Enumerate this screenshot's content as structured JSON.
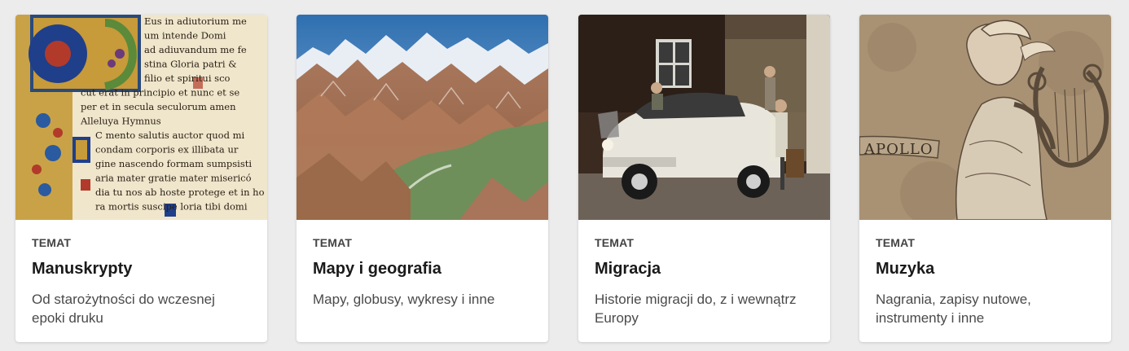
{
  "cards": [
    {
      "image": "illuminated-manuscript-image",
      "label": "TEMAT",
      "title": "Manuskrypty",
      "description": "Od starożytności do wczesnej epoki druku",
      "ms_lines": [
        "Eus in adiutorium me",
        "um intende  Domi",
        "ad adiuvandum me fe",
        "stina  Gloria patri &",
        "filio et spiritui sco",
        "cut erat in principio et nunc et se",
        "per et in secula seculorum amen",
        "Alleluya          Hymnus",
        "C mento salutis auctor quod mi",
        "condam corporis ex illibata ur",
        "gine nascendo formam sumpsisti",
        "aria mater gratie mater misericó",
        "dia tu nos ab hoste protege et in ho",
        "ra mortis suscipe  loria tibi domi"
      ]
    },
    {
      "image": "alpine-panorama-map-image",
      "label": "TEMAT",
      "title": "Mapy i geografia",
      "description": "Mapy, globusy, wykresy i inne"
    },
    {
      "image": "vintage-family-car-photo",
      "label": "TEMAT",
      "title": "Migracja",
      "description": "Historie migracji do, z i wewnątrz Europy"
    },
    {
      "image": "apollo-lyre-drawing",
      "label": "TEMAT",
      "title": "Muzyka",
      "description": "Nagrania, zapisy nutowe, instrumenty i inne",
      "apollo_text": "APOLLO"
    }
  ]
}
